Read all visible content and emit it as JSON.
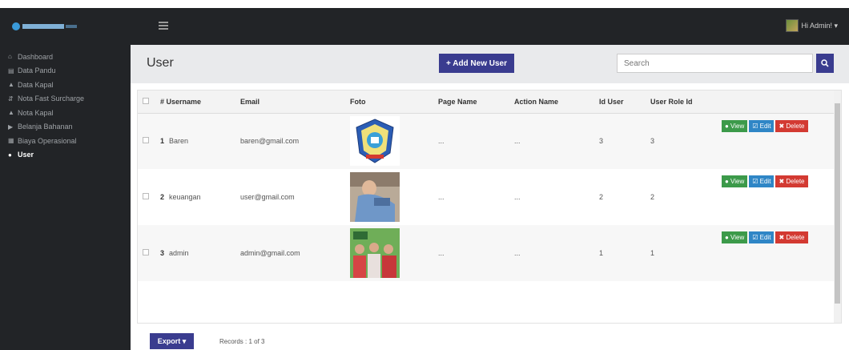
{
  "brand": {
    "logo_text": ""
  },
  "navbar": {
    "user_label": "Hi Admin! ▾"
  },
  "sidebar": {
    "items": [
      {
        "icon": "home-icon",
        "glyph": "⌂",
        "label": "Dashboard",
        "active": false
      },
      {
        "icon": "chart-icon",
        "glyph": "▤",
        "label": "Data Pandu",
        "active": false
      },
      {
        "icon": "ship-icon",
        "glyph": "▲",
        "label": "Data Kapal",
        "active": false
      },
      {
        "icon": "transfer-icon",
        "glyph": "⇵",
        "label": "Nota Fast Surcharge",
        "active": false
      },
      {
        "icon": "ship-icon",
        "glyph": "▲",
        "label": "Nota Kapal",
        "active": false
      },
      {
        "icon": "cart-icon",
        "glyph": "▶",
        "label": "Belanja Bahanan",
        "active": false
      },
      {
        "icon": "list-icon",
        "glyph": "▦",
        "label": "Biaya Operasional",
        "active": false
      },
      {
        "icon": "user-icon",
        "glyph": "●",
        "label": "User",
        "active": true
      }
    ]
  },
  "header": {
    "title": "User",
    "add_label": "+ Add New User",
    "search_placeholder": "Search"
  },
  "table": {
    "columns": [
      "# Username",
      "Email",
      "Foto",
      "Page Name",
      "Action Name",
      "Id User",
      "User Role Id",
      ""
    ],
    "rows": [
      {
        "no": "1",
        "username": "Baren",
        "email": "baren@gmail.com",
        "page": "...",
        "action": "...",
        "id_user": "3",
        "role_id": "3"
      },
      {
        "no": "2",
        "username": "keuangan",
        "email": "user@gmail.com",
        "page": "...",
        "action": "...",
        "id_user": "2",
        "role_id": "2"
      },
      {
        "no": "3",
        "username": "admin",
        "email": "admin@gmail.com",
        "page": "...",
        "action": "...",
        "id_user": "1",
        "role_id": "1"
      }
    ],
    "view_label": "● View",
    "edit_label": "☑ Edit",
    "delete_label": "✖ Delete"
  },
  "footer": {
    "export_label": "Export ▾",
    "records": "Records : 1 of 3"
  },
  "colors": {
    "sidebar_bg": "#222427",
    "primary": "#3a3c8f",
    "view": "#3c9a4a",
    "edit": "#2f86c6",
    "delete": "#d33a32"
  }
}
